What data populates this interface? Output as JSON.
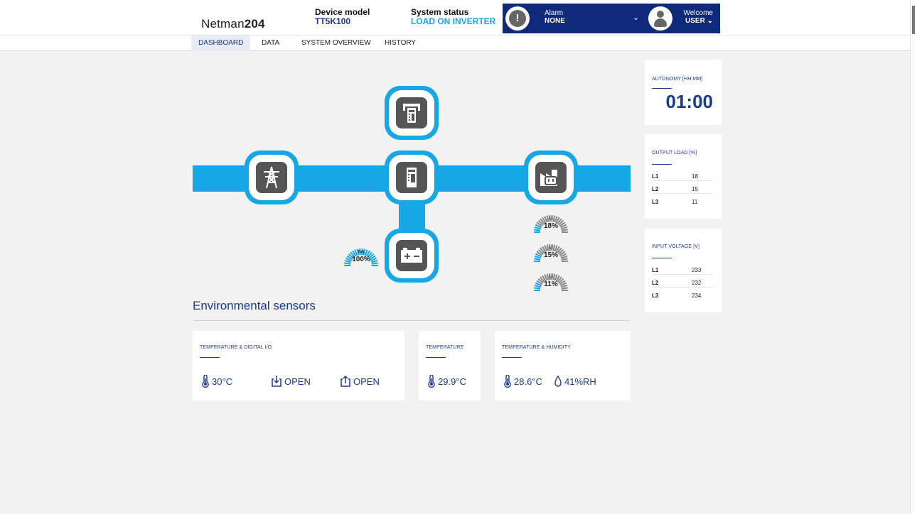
{
  "header": {
    "logo_light": "Netman",
    "logo_bold": "204",
    "device_model_label": "Device model",
    "device_model_value": "TT5K100",
    "system_status_label": "System status",
    "system_status_value": "LOAD ON INVERTER",
    "alarm_label": "Alarm",
    "alarm_value": "NONE",
    "welcome_label": "Welcome",
    "welcome_value": "USER"
  },
  "tabs": [
    {
      "label": "DASHBOARD",
      "active": true
    },
    {
      "label": "DATA",
      "active": false
    },
    {
      "label": "SYSTEM OVERVIEW",
      "active": false
    },
    {
      "label": "HISTORY",
      "active": false
    }
  ],
  "diagram": {
    "battery_gauge": {
      "label": "Bat",
      "value": "100%",
      "level": 1.0
    },
    "output_gauges": [
      {
        "label": "L1",
        "value": "18%",
        "level": 0.18
      },
      {
        "label": "L2",
        "value": "15%",
        "level": 0.15
      },
      {
        "label": "L3",
        "value": "11%",
        "level": 0.11
      }
    ]
  },
  "autonomy": {
    "title": "AUTONOMY [HH:MM]",
    "value": "01:00"
  },
  "output_load": {
    "title": "OUTPUT LOAD [%]",
    "rows": [
      {
        "k": "L1",
        "v": "18"
      },
      {
        "k": "L2",
        "v": "15"
      },
      {
        "k": "L3",
        "v": "11"
      }
    ]
  },
  "input_voltage": {
    "title": "INPUT VOLTAGE [V]",
    "rows": [
      {
        "k": "L1",
        "v": "233"
      },
      {
        "k": "L2",
        "v": "232"
      },
      {
        "k": "L3",
        "v": "234"
      }
    ]
  },
  "environment": {
    "title": "Environmental sensors",
    "cards": [
      {
        "title": "TEMPERATURE & DIGITAL I/O",
        "temp": "30°C",
        "in": "OPEN",
        "out": "OPEN"
      },
      {
        "title": "TEMPERATURE",
        "temp": "29.9°C"
      },
      {
        "title": "TEMPERATURE & HUMIDITY",
        "temp": "28.6°C",
        "humidity": "41%RH"
      }
    ]
  },
  "colors": {
    "accent": "#17a7e6",
    "navy": "#0f2a7a",
    "text_blue": "#1a3a8f",
    "icon_grey": "#555555"
  }
}
